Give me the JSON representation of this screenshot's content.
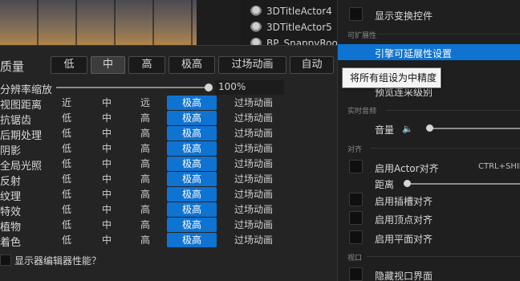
{
  "outliner": {
    "items": [
      {
        "label": "3DTitleActor4"
      },
      {
        "label": "3DTitleActor5"
      },
      {
        "label": "BP_SnappyRoo"
      }
    ]
  },
  "scalability": {
    "quality_label": "质量",
    "header_buttons": [
      "低",
      "中",
      "高",
      "极高",
      "过场动画",
      "自动"
    ],
    "active_header": "中",
    "resolution_label": "分辨率缩放",
    "resolution_value": "100%",
    "resolution_fraction": 1.0,
    "rows": [
      {
        "label": "视图距离",
        "options": [
          "近",
          "中",
          "远",
          "极高",
          "过场动画"
        ],
        "selected": 3
      },
      {
        "label": "抗锯齿",
        "options": [
          "低",
          "中",
          "高",
          "极高",
          "过场动画"
        ],
        "selected": 3
      },
      {
        "label": "后期处理",
        "options": [
          "低",
          "中",
          "高",
          "极高",
          "过场动画"
        ],
        "selected": 3
      },
      {
        "label": "阴影",
        "options": [
          "低",
          "中",
          "高",
          "极高",
          "过场动画"
        ],
        "selected": 3
      },
      {
        "label": "全局光照",
        "options": [
          "低",
          "中",
          "高",
          "极高",
          "过场动画"
        ],
        "selected": 3
      },
      {
        "label": "反射",
        "options": [
          "低",
          "中",
          "高",
          "极高",
          "过场动画"
        ],
        "selected": 3
      },
      {
        "label": "纹理",
        "options": [
          "低",
          "中",
          "高",
          "极高",
          "过场动画"
        ],
        "selected": 3
      },
      {
        "label": "特效",
        "options": [
          "低",
          "中",
          "高",
          "极高",
          "过场动画"
        ],
        "selected": 3
      },
      {
        "label": "植物",
        "options": [
          "低",
          "中",
          "高",
          "极高",
          "过场动画"
        ],
        "selected": 3
      },
      {
        "label": "着色",
        "options": [
          "低",
          "中",
          "高",
          "极高",
          "过场动画"
        ],
        "selected": 3
      }
    ],
    "monitor_label": "显示器编辑器性能？"
  },
  "right_panel": {
    "show_transform_label": "显示变换控件",
    "section_extensible": "可扩展性",
    "engine_scalability_label": "引擎可延展性设置",
    "material_quality_label": "预览连采级别",
    "section_realtime_audio": "实时音频",
    "volume_label": "音量",
    "volume_fraction": 0.0,
    "section_snap": "对齐",
    "actor_snap_label": "启用Actor对齐",
    "actor_snap_shortcut": "CTRL+SHIFT",
    "distance_label": "距离",
    "distance_fraction": 0.0,
    "socket_snap_label": "启用插槽对齐",
    "vertex_snap_label": "启用顶点对齐",
    "plane_snap_label": "启用平面对齐",
    "section_viewport": "视口",
    "hide_viewport_ui_label": "隐藏视口界面"
  },
  "tooltip": {
    "text": "将所有组设为中精度"
  },
  "colors": {
    "accent": "#0f73d1",
    "panel_bg": "#242424",
    "tooltip_bg": "#f4f4f4"
  }
}
